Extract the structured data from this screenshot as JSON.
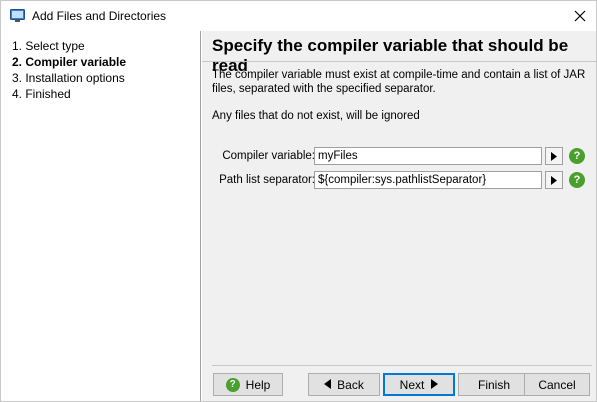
{
  "window": {
    "title": "Add Files and Directories",
    "icons": {
      "app": "window-app-icon",
      "close": "close-icon"
    }
  },
  "sidebar": {
    "steps": [
      {
        "label": "1. Select type",
        "active": false
      },
      {
        "label": "2. Compiler variable",
        "active": true
      },
      {
        "label": "3. Installation options",
        "active": false
      },
      {
        "label": "4. Finished",
        "active": false
      }
    ]
  },
  "main": {
    "heading": "Specify the compiler variable that should be read",
    "description": "The compiler variable must exist at compile-time and contain a list of JAR files, separated with the specified separator.",
    "note": "Any files that do not exist, will be ignored",
    "fields": [
      {
        "label": "Compiler variable:",
        "value": "myFiles"
      },
      {
        "label": "Path list separator:",
        "value": "${compiler:sys.pathlistSeparator}"
      }
    ],
    "help_glyph": "?"
  },
  "buttons": {
    "help": "Help",
    "back": "Back",
    "next": "Next",
    "finish": "Finish",
    "cancel": "Cancel"
  },
  "colors": {
    "help_green": "#4aa02c",
    "focus_blue": "#0078d7",
    "panel_bg": "#f0f0f0"
  }
}
